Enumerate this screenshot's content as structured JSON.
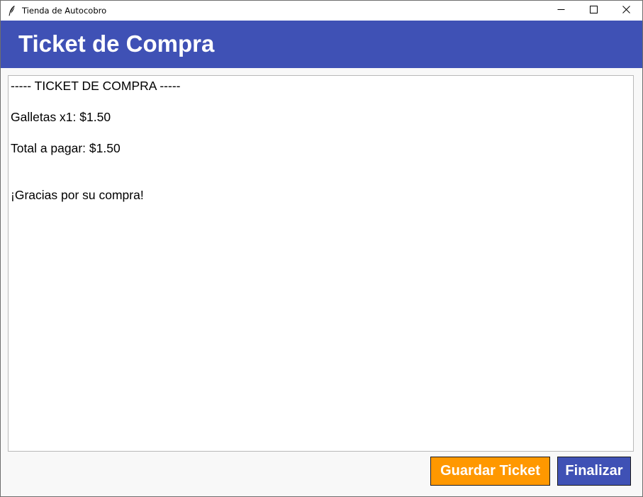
{
  "window": {
    "title": "Tienda de Autocobro"
  },
  "header": {
    "title": "Ticket de Compra",
    "background_color": "#3f51b5"
  },
  "ticket": {
    "lines": [
      "----- TICKET DE COMPRA -----",
      "Galletas x1: $1.50",
      "Total a pagar: $1.50",
      "¡Gracias por su compra!"
    ]
  },
  "actions": {
    "save_label": "Guardar Ticket",
    "save_color": "#ff9800",
    "finish_label": "Finalizar",
    "finish_color": "#3f51b5"
  },
  "icons": {
    "app": "feather-icon",
    "minimize": "minimize-icon",
    "maximize": "maximize-icon",
    "close": "close-icon"
  }
}
